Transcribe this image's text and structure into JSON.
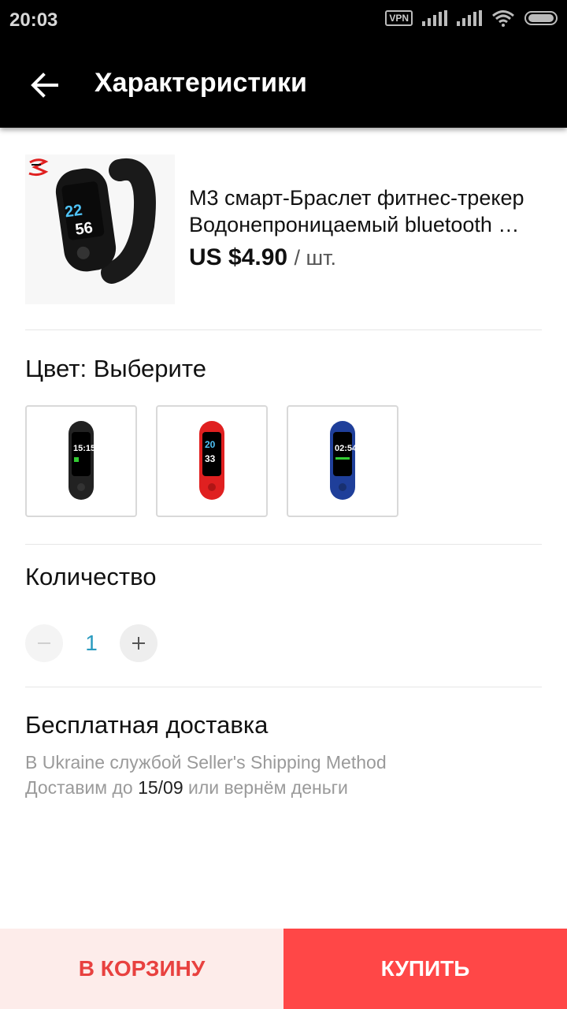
{
  "status_bar": {
    "time": "20:03",
    "vpn_label": "VPN",
    "icons": [
      "vpn-icon",
      "signal-icon",
      "signal-icon",
      "wifi-icon",
      "battery-icon"
    ]
  },
  "app_bar": {
    "back_icon": "arrow-left-icon",
    "title": "Характеристики"
  },
  "product": {
    "name_line1": "M3 смарт-Браслет фитнес-трекер",
    "name_line2": "Водонепроницаемый bluetooth …",
    "price": "US $4.90",
    "unit": "/ шт.",
    "brand_logo_text": "LotGeek"
  },
  "color_section": {
    "title": "Цвет: Выберите",
    "options": [
      {
        "name": "black",
        "accent": "#222222",
        "screen_text": "15:15"
      },
      {
        "name": "red",
        "accent": "#e02020",
        "screen_text": "20 33"
      },
      {
        "name": "blue",
        "accent": "#1f3f9a",
        "screen_text": "02:54"
      }
    ]
  },
  "quantity_section": {
    "title": "Количество",
    "value": "1",
    "minus_icon": "minus-icon",
    "plus_icon": "plus-icon"
  },
  "shipping": {
    "title": "Бесплатная доставка",
    "method_line": "В Ukraine службой Seller's Shipping Method",
    "delivery_prefix": "Доставим до ",
    "delivery_date": "15/09",
    "delivery_suffix": " или вернём деньги"
  },
  "actions": {
    "cart_label": "В КОРЗИНУ",
    "buy_label": "КУПИТЬ"
  },
  "colors": {
    "accent": "#ff4747",
    "cart_bg": "#fdecea",
    "cart_text": "#e8413f",
    "quantity_text": "#2a9bbf"
  }
}
